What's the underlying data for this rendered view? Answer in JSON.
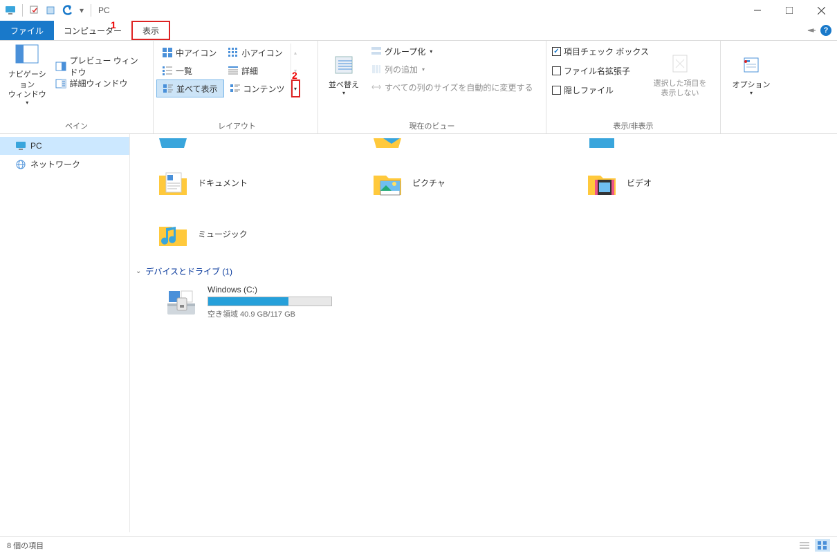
{
  "title": "PC",
  "tabs": {
    "file": "ファイル",
    "computer": "コンピューター",
    "view": "表示"
  },
  "annotations": {
    "marker1": "1",
    "marker2": "2"
  },
  "ribbon": {
    "pane": {
      "title": "ペイン",
      "nav_pane": "ナビゲーション\nウィンドウ",
      "preview": "プレビュー ウィンドウ",
      "details": "詳細ウィンドウ"
    },
    "layout": {
      "title": "レイアウト",
      "medium_icons": "中アイコン",
      "small_icons": "小アイコン",
      "list": "一覧",
      "details": "詳細",
      "tiles": "並べて表示",
      "content": "コンテンツ"
    },
    "current_view": {
      "title": "現在のビュー",
      "sort": "並べ替え",
      "group": "グループ化",
      "add_columns": "列の追加",
      "size_all_columns": "すべての列のサイズを自動的に変更する"
    },
    "show_hide": {
      "title": "表示/非表示",
      "item_checkboxes": "項目チェック ボックス",
      "filename_ext": "ファイル名拡張子",
      "hidden_items": "隠しファイル",
      "hide_selected": "選択した項目を\n表示しない"
    },
    "options": "オプション"
  },
  "nav": {
    "pc": "PC",
    "network": "ネットワーク"
  },
  "folders": {
    "documents": "ドキュメント",
    "pictures": "ピクチャ",
    "videos": "ビデオ",
    "music": "ミュージック"
  },
  "devices_section": "デバイスとドライブ (1)",
  "drive": {
    "name": "Windows (C:)",
    "sub": "空き領域 40.9 GB/117 GB"
  },
  "statusbar": "8 個の項目"
}
